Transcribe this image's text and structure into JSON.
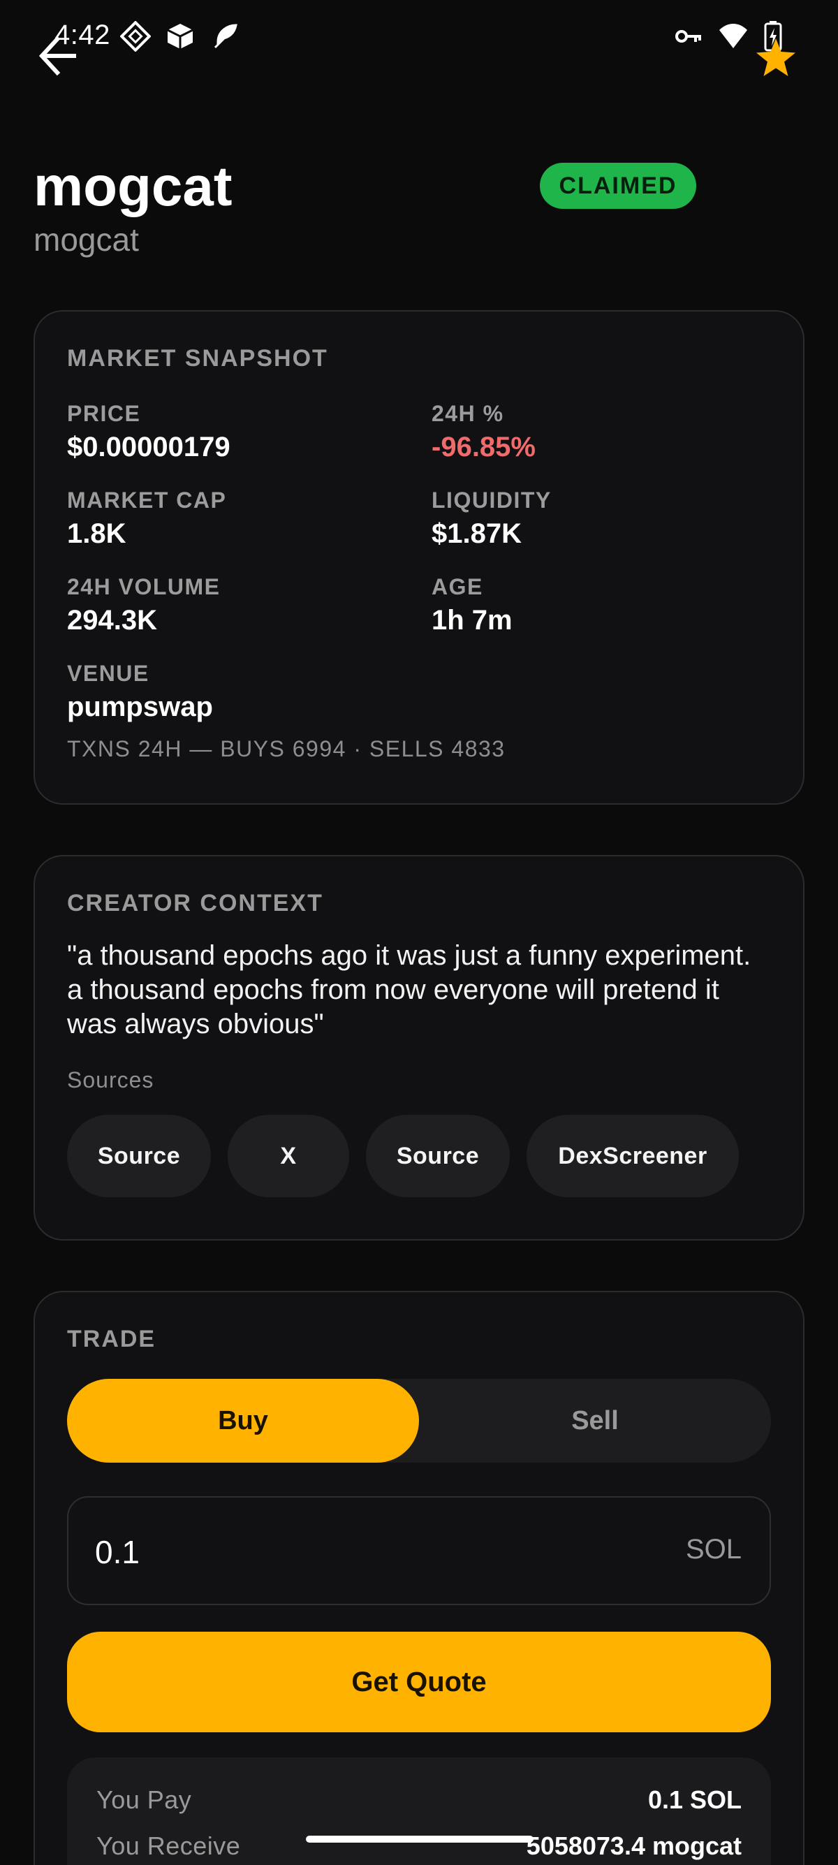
{
  "status_bar": {
    "time": "4:42"
  },
  "header": {
    "title": "mogcat",
    "subtitle": "mogcat",
    "badge": "CLAIMED",
    "favorite_color": "#ffb300"
  },
  "market_snapshot": {
    "title": "MARKET SNAPSHOT",
    "stats": [
      {
        "label": "PRICE",
        "value": "$0.00000179"
      },
      {
        "label": "24H %",
        "value": "-96.85%"
      },
      {
        "label": "MARKET CAP",
        "value": "1.8K"
      },
      {
        "label": "LIQUIDITY",
        "value": "$1.87K"
      },
      {
        "label": "24H VOLUME",
        "value": "294.3K"
      },
      {
        "label": "AGE",
        "value": "1h 7m"
      },
      {
        "label": "VENUE",
        "value": "pumpswap"
      }
    ],
    "txns": "TXNS 24H — BUYS 6994 · SELLS 4833"
  },
  "creator_context": {
    "title": "CREATOR CONTEXT",
    "quote": "\"a thousand epochs ago it was just a funny experiment. a thousand epochs from now everyone will pretend it was always obvious\"",
    "sources_label": "Sources",
    "sources": [
      "Source",
      "X",
      "Source",
      "DexScreener"
    ]
  },
  "trade": {
    "title": "TRADE",
    "buy_label": "Buy",
    "sell_label": "Sell",
    "amount_value": "0.1",
    "amount_unit": "SOL",
    "quote_button": "Get Quote",
    "summary": {
      "pay_label": "You Pay",
      "pay_value": "0.1 SOL",
      "receive_label": "You Receive",
      "receive_value": "5058073.4 mogcat"
    }
  },
  "colors": {
    "accent": "#ffb300",
    "claimed": "#1fb54a",
    "negative": "#f06b6b",
    "background": "#0b0b0c"
  }
}
